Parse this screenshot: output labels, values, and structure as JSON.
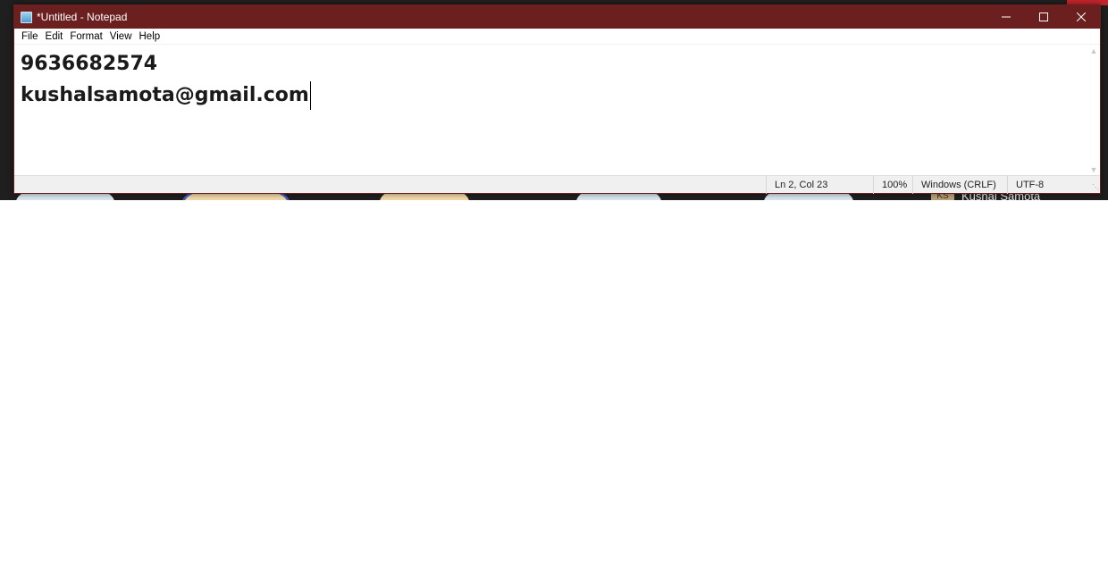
{
  "background": {
    "participant_initials": "KS",
    "participant_name": "Kushal Samota"
  },
  "window": {
    "title": "*Untitled - Notepad",
    "accent_color": "#6b1f1f"
  },
  "menu": {
    "items": [
      "File",
      "Edit",
      "Format",
      "View",
      "Help"
    ]
  },
  "editor": {
    "lines": [
      "9636682574",
      "kushalsamota@gmail.com"
    ]
  },
  "status": {
    "position": "Ln 2, Col 23",
    "zoom": "100%",
    "line_ending": "Windows (CRLF)",
    "encoding": "UTF-8"
  },
  "icons": {
    "app": "notepad-icon",
    "minimize": "minimize-icon",
    "maximize": "maximize-icon",
    "close": "close-icon"
  }
}
